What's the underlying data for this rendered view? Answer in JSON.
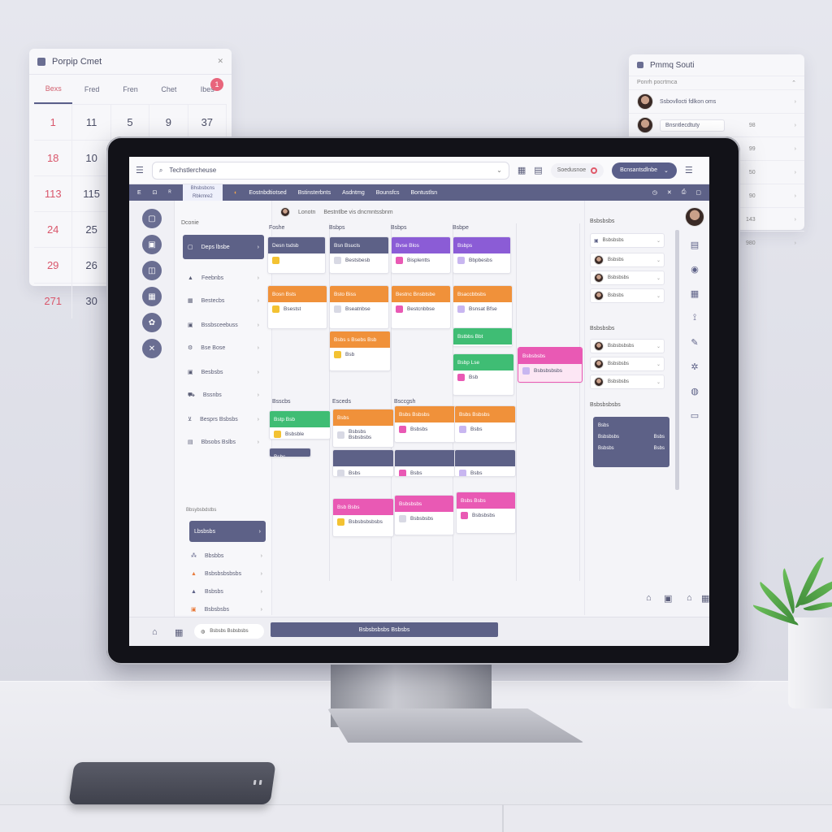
{
  "wall_calendar": {
    "title": "Porpip Cmet",
    "days_of_week": [
      "Bexs",
      "Fred",
      "Fren",
      "Chet",
      "Ibes"
    ],
    "badge": "1",
    "rows": [
      [
        "1",
        "11",
        "5",
        "9",
        "37"
      ],
      [
        "18",
        "10",
        "",
        "",
        ""
      ],
      [
        "113",
        "115",
        "",
        "",
        ""
      ],
      [
        "24",
        "25",
        "",
        "",
        ""
      ],
      [
        "29",
        "26",
        "",
        "",
        ""
      ],
      [
        "271",
        "30",
        "",
        "",
        ""
      ]
    ]
  },
  "wall_people": {
    "title": "Pmmq Souti",
    "subheader": "Ponrh pocrtmca",
    "rows": [
      {
        "name": "Ssbovllocti fdlkon oms",
        "num": ""
      },
      {
        "name": "Bnsntlecdtuty",
        "num": "98"
      },
      {
        "name": "",
        "num": "99"
      },
      {
        "name": "",
        "num": "50"
      },
      {
        "name": "",
        "num": "90"
      },
      {
        "name": "",
        "num": "143"
      },
      {
        "name": "",
        "num": "980"
      }
    ]
  },
  "app": {
    "search_text": "Techstlercheuse",
    "pill_text": "Soedusnoe",
    "dark_button": "Bcnsantsdlnbe",
    "nav_tab_line1": "Bhsbsbcns",
    "nav_tab_line2": "Rbkrnre2",
    "nav_items": [
      "Eostnbdtiotsed",
      "Bstinsterbnts",
      "Asdntmg",
      "Bounsfcs",
      "Bontustlsn"
    ],
    "board_head": [
      "Lonotn",
      "Bestntlbe vis dncmntssbnm"
    ],
    "sidebar_title": "Dconie",
    "sidebar_items": [
      {
        "label": "Deps lbsbe",
        "icon": "folder-icon"
      },
      {
        "label": "Feebnbs",
        "icon": "triangle-icon"
      },
      {
        "label": "Bestecbs",
        "icon": "calendar-icon"
      },
      {
        "label": "Bssbsceebuss",
        "icon": "image-icon"
      },
      {
        "label": "Bse Bose",
        "icon": "gear-icon"
      },
      {
        "label": "Besbsbs",
        "icon": "box-icon"
      },
      {
        "label": "Bssnbs",
        "icon": "car-icon"
      },
      {
        "label": "Besprs Bsbsbs",
        "icon": "cup-icon"
      },
      {
        "label": "Bbsobs Bslbs",
        "icon": "doc-icon"
      }
    ],
    "sidebar_section": "Bbsybsbdstbs",
    "sidebar_active2": "Lbsbsbs",
    "sidebar_sub": [
      "Bbsbbs",
      "Bsbsbsbsbsbs",
      "Bsbsbs",
      "Bsbsbsbs"
    ],
    "columns": [
      "Foshe",
      "Bsbps",
      "Bsbps",
      "Bsbpe"
    ],
    "columns2": [
      "Bsscbs",
      "Esceds",
      "Bsccgsh"
    ],
    "cards": [
      {
        "head": "Desn tsdsb",
        "body": "",
        "color": "#5d6187"
      },
      {
        "head": "Bsn Bsucls",
        "body": "Bestsbesb",
        "color": "#5d6187"
      },
      {
        "head": "Bvse Blos",
        "body": "Bisplentts",
        "color": "#8b5cd6"
      },
      {
        "head": "Bsbps",
        "body": "Bbpbesbs",
        "color": "#8b5cd6"
      },
      {
        "head": "Bosn Bsts",
        "body": "Bsestst",
        "color": "#f0913a"
      },
      {
        "head": "Bsto Biss",
        "body": "Bseatnbse",
        "color": "#f0913a"
      },
      {
        "head": "Bestnc Bnsbtsbe",
        "body": "Bestcnbbse",
        "color": "#f0913a"
      },
      {
        "head": "Bsaccbbsbs",
        "body": "Bsnsat Bfse",
        "color": "#f0913a"
      },
      {
        "head": "Bsbs s Bsebs Bsb",
        "body": "Bsb",
        "color": "#f0913a"
      },
      {
        "head": "Bstbbs Bbt",
        "body": "",
        "color": "#3fbd74"
      },
      {
        "head": "Bsbp Lse",
        "body": "Bsb",
        "color": "#3fbd74"
      },
      {
        "head": "Bsbsbsbs",
        "body": "Bsbsbsbsbs",
        "color": "#e959b4"
      },
      {
        "head": "Bstp Bsb",
        "body": "Bsbsble",
        "color": "#3fbd74"
      },
      {
        "head": "Bsbs",
        "body": "Bsbsbs Bsbsbsbs",
        "color": "#f0913a"
      },
      {
        "head": "Bsbs Bsbsbs",
        "body": "Bsbsbs",
        "color": "#f0913a"
      },
      {
        "head": "Bsbs Bsbsbs",
        "body": "Bsbs",
        "color": "#f0913a"
      },
      {
        "head": "Bsbs",
        "body": "",
        "color": "#5d6187"
      },
      {
        "head": "",
        "body": "Bsbs",
        "color": "#5d6187"
      },
      {
        "head": "",
        "body": "Bsbs",
        "color": "#5d6187"
      },
      {
        "head": "",
        "body": "Bsbs",
        "color": "#5d6187"
      },
      {
        "head": "Bsb Bsbs",
        "body": "Bsbsbsbsbsbs",
        "color": "#e959b4"
      },
      {
        "head": "Bsbsbsbs",
        "body": "Bsbsbsbs",
        "color": "#e959b4"
      },
      {
        "head": "Bsbs Bsbs",
        "body": "Bsbsbsbs",
        "color": "#e959b4"
      }
    ],
    "right_panel": {
      "title1": "Bsbsbsbs",
      "items1": [
        "Bsbsbsbs",
        "Bsbsbs",
        "Bsbsbsbs",
        "Bsbsbs"
      ],
      "title2": "Bsbsbsbs",
      "items2": [
        "Bsbsbsbsbs",
        "Bsbsbsbs",
        "Bsbsbsbs"
      ],
      "title3": "Bsbsbsbsbs",
      "stats": [
        [
          "Bsbs",
          ""
        ],
        [
          "Bsbsbsbs",
          "Bsbs"
        ],
        [
          "Bsbsbs",
          "Bsbs"
        ]
      ]
    },
    "bottom_input": "Bsbsbs Bsbsbsbs",
    "bottom_button": "Bsbsbsbsbs Bsbsbs"
  }
}
